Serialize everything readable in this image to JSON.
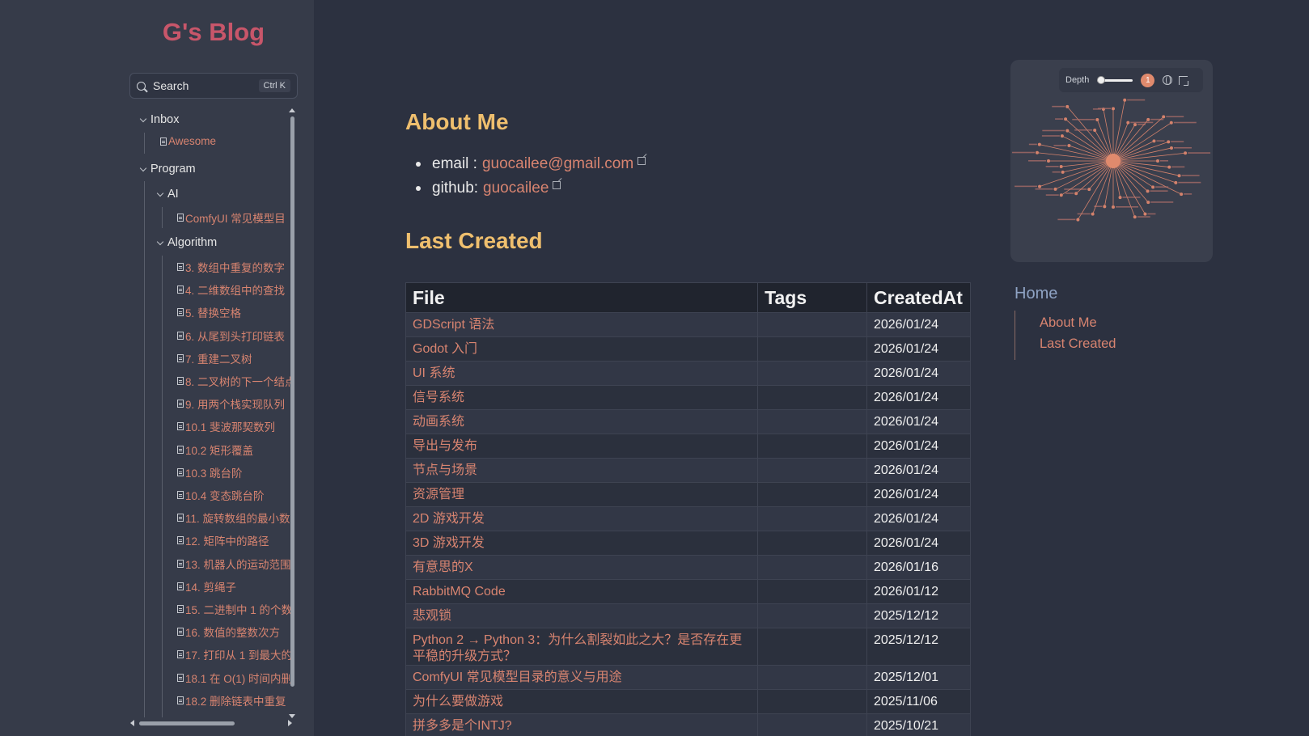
{
  "site": {
    "title": "G's Blog"
  },
  "search": {
    "label": "Search",
    "shortcut": "Ctrl K"
  },
  "tree": {
    "inbox": {
      "label": "Inbox",
      "items": [
        "Awesome"
      ]
    },
    "program": {
      "label": "Program"
    },
    "ai": {
      "label": "AI",
      "items": [
        "ComfyUI 常见模型目"
      ]
    },
    "algorithm": {
      "label": "Algorithm",
      "items": [
        "3. 数组中重复的数字",
        "4. 二维数组中的查找",
        "5. 替换空格",
        "6. 从尾到头打印链表",
        "7. 重建二叉树",
        "8. 二叉树的下一个结点",
        "9. 用两个栈实现队列",
        "10.1 斐波那契数列",
        "10.2 矩形覆盖",
        "10.3 跳台阶",
        "10.4 变态跳台阶",
        "11. 旋转数组的最小数",
        "12. 矩阵中的路径",
        "13. 机器人的运动范围",
        "14. 剪绳子",
        "15. 二进制中 1 的个数",
        "16. 数值的整数次方",
        "17. 打印从 1 到最大的",
        "18.1 在 O(1) 时间内删",
        "18.2 删除链表中重复"
      ]
    }
  },
  "about": {
    "heading": "About Me",
    "email_label": "email :",
    "email_value": "guocailee@gmail.com",
    "github_label": "github:",
    "github_value": "guocailee"
  },
  "last_created": {
    "heading": "Last Created",
    "columns": [
      "File",
      "Tags",
      "CreatedAt"
    ],
    "rows": [
      [
        "GDScript 语法",
        "",
        "2026/01/24"
      ],
      [
        "Godot 入门",
        "",
        "2026/01/24"
      ],
      [
        "UI 系统",
        "",
        "2026/01/24"
      ],
      [
        "信号系统",
        "",
        "2026/01/24"
      ],
      [
        "动画系统",
        "",
        "2026/01/24"
      ],
      [
        "导出与发布",
        "",
        "2026/01/24"
      ],
      [
        "节点与场景",
        "",
        "2026/01/24"
      ],
      [
        "资源管理",
        "",
        "2026/01/24"
      ],
      [
        "2D 游戏开发",
        "",
        "2026/01/24"
      ],
      [
        "3D 游戏开发",
        "",
        "2026/01/24"
      ],
      [
        "有意思的X",
        "",
        "2026/01/16"
      ],
      [
        "RabbitMQ Code",
        "",
        "2026/01/12"
      ],
      [
        "悲观锁",
        "",
        "2025/12/12"
      ],
      [
        "Python 2 → Python 3：为什么割裂如此之大？是否存在更平稳的升级方式？",
        "",
        "2025/12/12"
      ],
      [
        "ComfyUI 常见模型目录的意义与用途",
        "",
        "2025/12/01"
      ],
      [
        "为什么要做游戏",
        "",
        "2025/11/06"
      ],
      [
        "拼多多是个INTJ?",
        "",
        "2025/10/21"
      ]
    ]
  },
  "graph": {
    "depth_label": "Depth",
    "depth_value": "1",
    "depth_level": 0.1
  },
  "toc": {
    "title": "Home",
    "items": [
      "About Me",
      "Last Created"
    ]
  },
  "colors": {
    "accent_title": "#c8566a",
    "heading": "#efbf6e",
    "link": "#d88470",
    "toc_title": "#8fa3c4"
  }
}
